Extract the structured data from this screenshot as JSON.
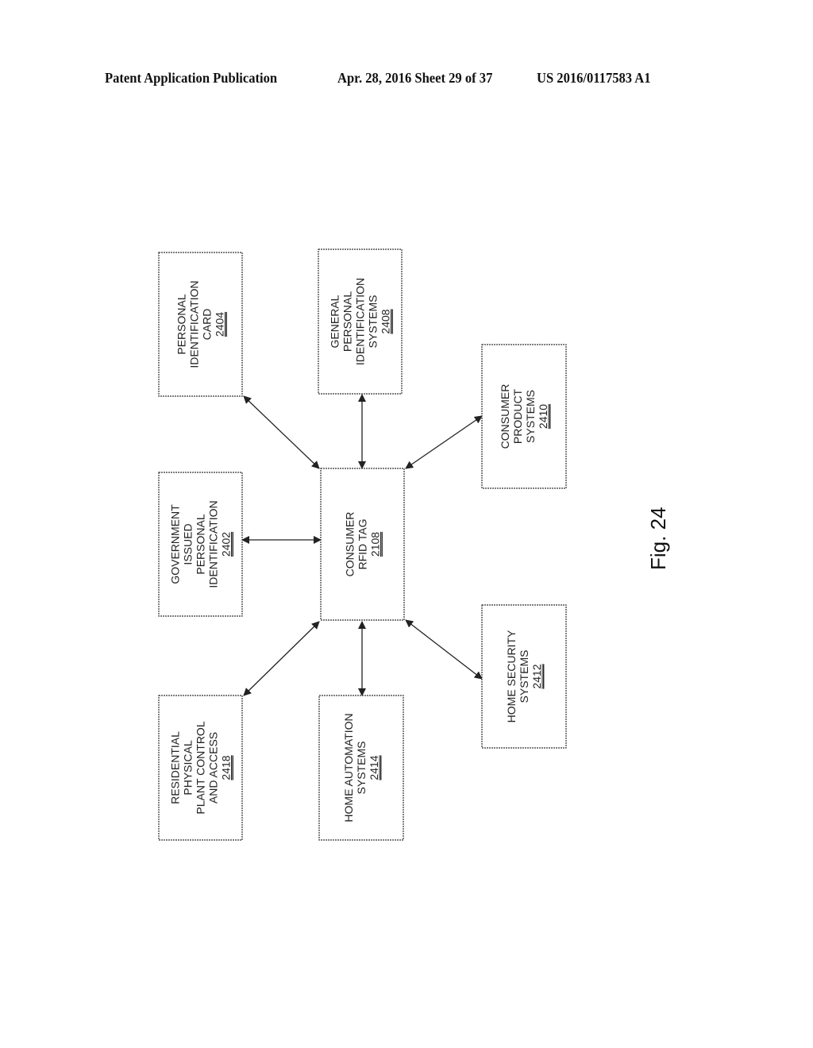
{
  "header": {
    "left": "Patent Application Publication",
    "middle": "Apr. 28, 2016  Sheet 29 of 37",
    "right": "US 2016/0117583 A1"
  },
  "figure_label": "Fig. 24",
  "center": {
    "id": "2108",
    "lines": [
      "CONSUMER",
      "RFID TAG"
    ],
    "ref": "2108"
  },
  "boxes": [
    {
      "id": "2404",
      "lines": [
        "PERSONAL",
        "IDENTIFICATION",
        "CARD"
      ],
      "ref": "2404"
    },
    {
      "id": "2408",
      "lines": [
        "GENERAL",
        "PERSONAL",
        "IDENTIFICATION",
        "SYSTEMS"
      ],
      "ref": "2408"
    },
    {
      "id": "2410",
      "lines": [
        "CONSUMER",
        "PRODUCT",
        "SYSTEMS"
      ],
      "ref": "2410"
    },
    {
      "id": "2402",
      "lines": [
        "GOVERNMENT",
        "ISSUED",
        "PERSONAL",
        "IDENTIFICATION"
      ],
      "ref": "2402"
    },
    {
      "id": "2412",
      "lines": [
        "HOME SECURITY",
        "SYSTEMS"
      ],
      "ref": "2412"
    },
    {
      "id": "2418",
      "lines": [
        "RESIDENTIAL",
        "PHYSICAL",
        "PLANT CONTROL",
        "AND ACCESS"
      ],
      "ref": "2418"
    },
    {
      "id": "2414",
      "lines": [
        "HOME AUTOMATION",
        "SYSTEMS"
      ],
      "ref": "2414"
    }
  ],
  "connections": [
    {
      "from": "2108",
      "to": "2404",
      "type": "bidirectional"
    },
    {
      "from": "2108",
      "to": "2408",
      "type": "bidirectional"
    },
    {
      "from": "2108",
      "to": "2410",
      "type": "bidirectional"
    },
    {
      "from": "2108",
      "to": "2402",
      "type": "bidirectional"
    },
    {
      "from": "2108",
      "to": "2412",
      "type": "bidirectional"
    },
    {
      "from": "2108",
      "to": "2418",
      "type": "bidirectional"
    },
    {
      "from": "2108",
      "to": "2414",
      "type": "bidirectional"
    }
  ]
}
